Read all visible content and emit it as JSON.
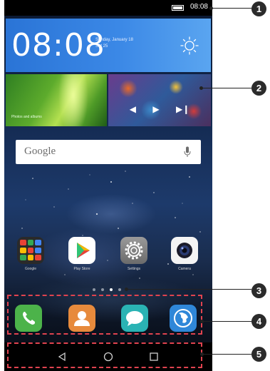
{
  "status_bar": {
    "time": "08:08",
    "battery_icon": "battery-icon"
  },
  "clock_widget": {
    "time": "08:08",
    "date_line1": "Sunday, January 18",
    "date_line2": "Sat 25",
    "weather_icon": "sun-icon"
  },
  "photo_widget": {
    "caption": "Photos and albums"
  },
  "music_widget": {
    "controls": [
      "previous-icon",
      "play-icon",
      "next-icon"
    ]
  },
  "search": {
    "logo": "Google",
    "mic_icon": "mic-icon"
  },
  "apps": [
    {
      "label": "Google",
      "icon": "folder-icon"
    },
    {
      "label": "Play Store",
      "icon": "play-store-icon"
    },
    {
      "label": "Settings",
      "icon": "settings-icon"
    },
    {
      "label": "Camera",
      "icon": "camera-icon"
    }
  ],
  "page_indicator": {
    "pages": 4,
    "active": 2
  },
  "dock": [
    {
      "icon": "phone-icon"
    },
    {
      "icon": "contacts-icon"
    },
    {
      "icon": "messages-icon"
    },
    {
      "icon": "browser-icon"
    }
  ],
  "nav_bar": {
    "buttons": [
      "back-icon",
      "home-icon",
      "recents-icon"
    ]
  },
  "callouts": [
    "1",
    "2",
    "3",
    "4",
    "5"
  ],
  "colors": {
    "callout_dash": "#e0434f",
    "widget_blue": "#3b88e6"
  }
}
